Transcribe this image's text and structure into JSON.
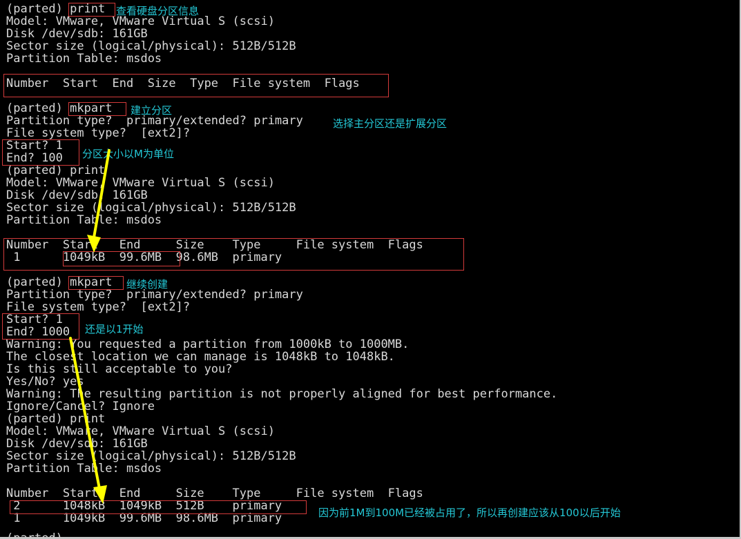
{
  "terminal": {
    "lines": [
      "(parted) print",
      "Model: VMware, VMware Virtual S (scsi)",
      "Disk /dev/sdb: 161GB",
      "Sector size (logical/physical): 512B/512B",
      "Partition Table: msdos",
      "",
      "Number  Start  End  Size  Type  File system  Flags",
      "",
      "(parted) mkpart",
      "Partition type?  primary/extended? primary",
      "File system type?  [ext2]?",
      "Start? 1",
      "End? 100",
      "(parted) print",
      "Model: VMware, VMware Virtual S (scsi)",
      "Disk /dev/sdb: 161GB",
      "Sector size (logical/physical): 512B/512B",
      "Partition Table: msdos",
      "",
      "Number  Start   End     Size    Type     File system  Flags",
      " 1      1049kB  99.6MB  98.6MB  primary",
      "",
      "(parted) mkpart",
      "Partition type?  primary/extended? primary",
      "File system type?  [ext2]?",
      "Start? 1",
      "End? 1000",
      "Warning: You requested a partition from 1000kB to 1000MB.",
      "The closest location we can manage is 1048kB to 1048kB.",
      "Is this still acceptable to you?",
      "Yes/No? yes",
      "Warning: The resulting partition is not properly aligned for best performance.",
      "Ignore/Cancel? Ignore",
      "(parted) print",
      "Model: VMware, VMware Virtual S (scsi)",
      "Disk /dev/sdb: 161GB",
      "Sector size (logical/physical): 512B/512B",
      "Partition Table: msdos",
      "",
      "Number  Start   End     Size    Type     File system  Flags",
      " 2      1048kB  1049kB  512B    primary",
      " 1      1049kB  99.6MB  98.6MB  primary",
      "",
      "(parted)"
    ]
  },
  "annotations": {
    "note_print": "查看硬盘分区信息",
    "note_mkpart": "建立分区",
    "note_type": "选择主分区还是扩展分区",
    "note_size": "分区大小以M为单位",
    "note_mkpart2": "继续创建",
    "note_start": "还是以1开始",
    "note_final": "因为前1M到100M已经被占用了，所以再创建应该从100以后开始"
  },
  "colors": {
    "background": "#000000",
    "text": "#d9d9d9",
    "annotation_text": "#24c8d6",
    "box_border": "#d43b3b",
    "arrow": "#ffff00"
  }
}
